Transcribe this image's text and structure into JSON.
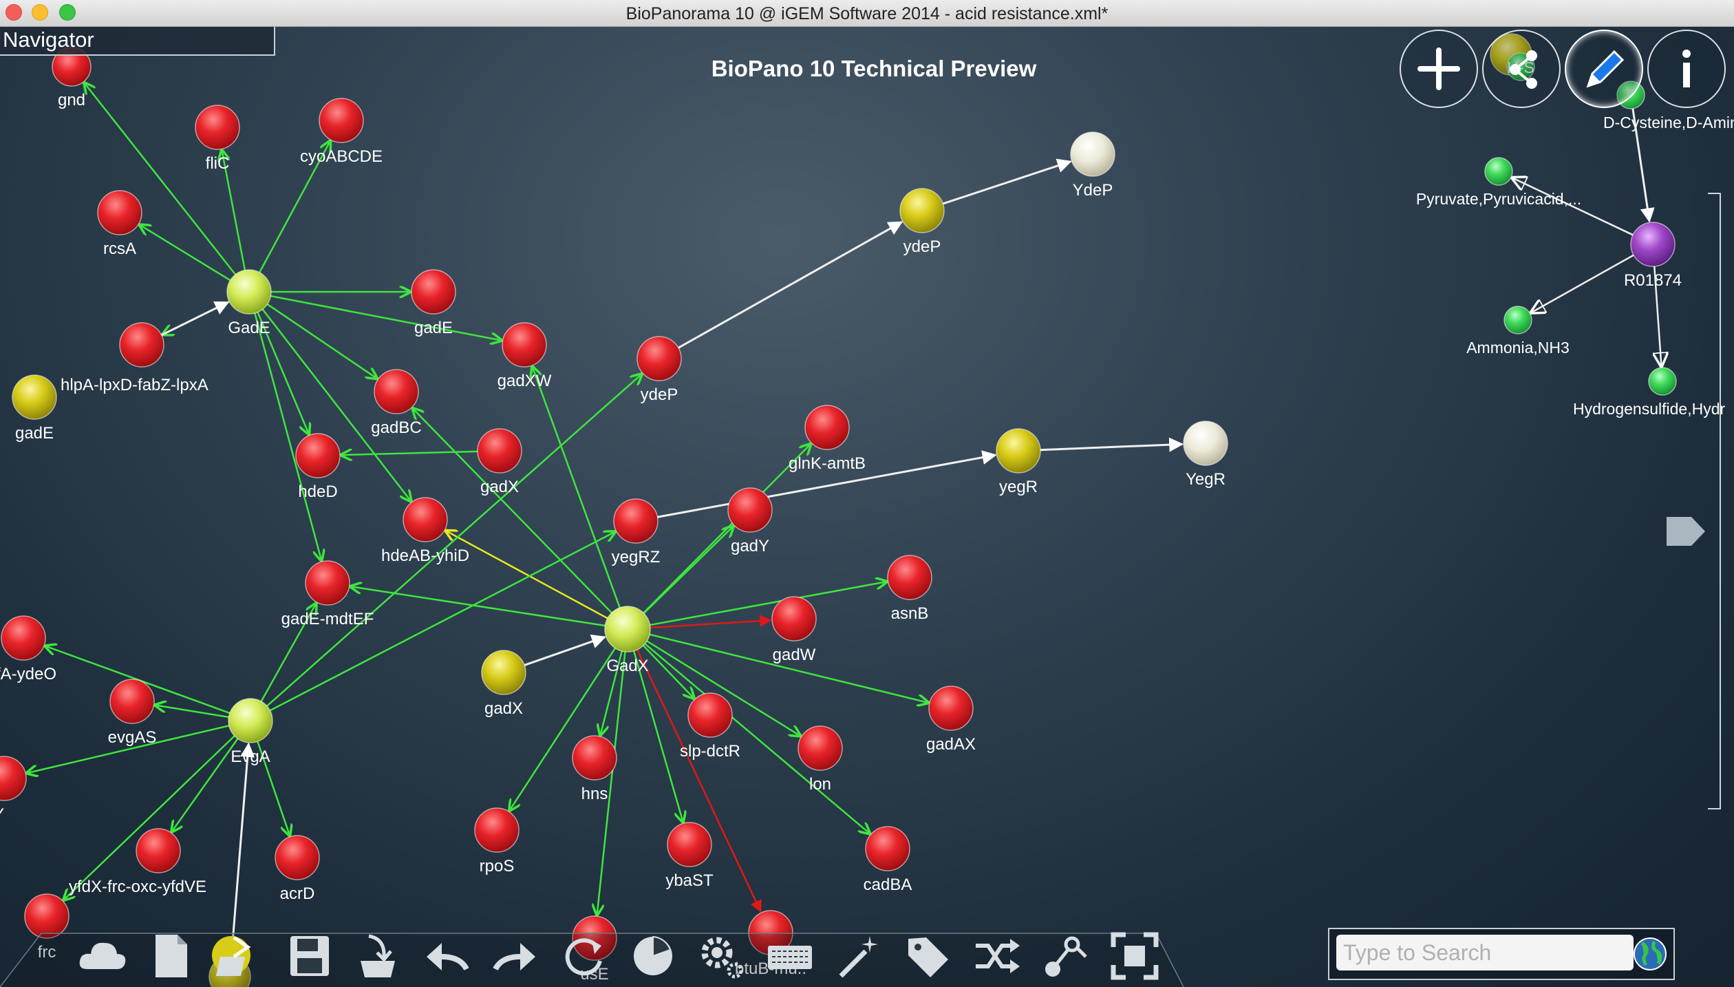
{
  "window": {
    "title": "BioPanorama 10 @ iGEM Software 2014 - acid resistance.xml*",
    "subtitle": "BioPano 10 Technical Preview"
  },
  "navigator": {
    "label": "Navigator"
  },
  "top_buttons": [
    {
      "name": "add-button",
      "icon": "plus-icon"
    },
    {
      "name": "share-button",
      "icon": "share-icon"
    },
    {
      "name": "edit-button",
      "icon": "pencil-icon",
      "active": true
    },
    {
      "name": "info-button",
      "icon": "info-icon"
    }
  ],
  "search": {
    "placeholder": "Type to Search",
    "value": ""
  },
  "bottom_toolbar": [
    "cloud-icon",
    "new-document-icon",
    "open-folder-icon",
    "save-icon",
    "import-icon",
    "undo-icon",
    "redo-icon",
    "refresh-icon",
    "pie-chart-icon",
    "settings-icon",
    "keyboard-icon",
    "magic-wand-icon",
    "tag-icon",
    "shuffle-icon",
    "connect-icon",
    "fullscreen-icon"
  ],
  "colors": {
    "activation": "#3ee63e",
    "repression": "#e01818",
    "inhibition_yellow": "#e8e820",
    "protein": "#d4ec5a",
    "gene": "#e8242a",
    "mrna": "#d8cc18",
    "product": "#ecead8",
    "compound": "#3ed85a",
    "reaction": "#a048c8",
    "background": "#2f4150"
  },
  "nodes": [
    {
      "id": "gnd",
      "label": "gnd",
      "type": "gene"
    },
    {
      "id": "fliC",
      "label": "fliC",
      "type": "gene"
    },
    {
      "id": "cyoABCDE",
      "label": "cyoABCDE",
      "type": "gene"
    },
    {
      "id": "rcsA",
      "label": "rcsA",
      "type": "gene"
    },
    {
      "id": "GadE",
      "label": "GadE",
      "type": "protein"
    },
    {
      "id": "gadE1",
      "label": "gadE",
      "type": "gene"
    },
    {
      "id": "gadXW",
      "label": "gadXW",
      "type": "gene"
    },
    {
      "id": "gadBC",
      "label": "gadBC",
      "type": "gene"
    },
    {
      "id": "hlpA",
      "label": "hlpA-lpxD-fabZ-lpxA",
      "type": "gene"
    },
    {
      "id": "gadE_m",
      "label": "gadE",
      "type": "mrna"
    },
    {
      "id": "hdeD",
      "label": "hdeD",
      "type": "gene"
    },
    {
      "id": "hdeAB",
      "label": "hdeAB-yhiD",
      "type": "gene"
    },
    {
      "id": "gadX_g",
      "label": "gadX",
      "type": "gene"
    },
    {
      "id": "ydeP_g",
      "label": "ydeP",
      "type": "gene"
    },
    {
      "id": "ydeP_m",
      "label": "ydeP",
      "type": "mrna"
    },
    {
      "id": "YdeP",
      "label": "YdeP",
      "type": "product"
    },
    {
      "id": "gadEmdtEF",
      "label": "gadE-mdtEF",
      "type": "gene"
    },
    {
      "id": "yegRZ",
      "label": "yegRZ",
      "type": "gene"
    },
    {
      "id": "gadY",
      "label": "gadY",
      "type": "gene"
    },
    {
      "id": "glnK",
      "label": "glnK-amtB",
      "type": "gene"
    },
    {
      "id": "yegR_m",
      "label": "yegR",
      "type": "mrna"
    },
    {
      "id": "YegR",
      "label": "YegR",
      "type": "product"
    },
    {
      "id": "asnB",
      "label": "asnB",
      "type": "gene"
    },
    {
      "id": "GadX",
      "label": "GadX",
      "type": "protein"
    },
    {
      "id": "gadW",
      "label": "gadW",
      "type": "gene"
    },
    {
      "id": "gadX_m",
      "label": "gadX",
      "type": "mrna"
    },
    {
      "id": "gadAX",
      "label": "gadAX",
      "type": "gene"
    },
    {
      "id": "slp",
      "label": "slp-dctR",
      "type": "gene"
    },
    {
      "id": "lon",
      "label": "lon",
      "type": "gene"
    },
    {
      "id": "hns",
      "label": "hns",
      "type": "gene"
    },
    {
      "id": "rpoS",
      "label": "rpoS",
      "type": "gene"
    },
    {
      "id": "ybaST",
      "label": "ybaST",
      "type": "gene"
    },
    {
      "id": "cadBA",
      "label": "cadBA",
      "type": "gene"
    },
    {
      "id": "usE",
      "label": "usE",
      "type": "gene"
    },
    {
      "id": "btuB",
      "label": "btuB-mu..",
      "type": "gene"
    },
    {
      "id": "safA",
      "label": "fA-ydeO",
      "type": "gene"
    },
    {
      "id": "evgAS",
      "label": "evgAS",
      "type": "gene"
    },
    {
      "id": "EvgA",
      "label": "EvgA",
      "type": "protein"
    },
    {
      "id": "rKY",
      "label": "rKY",
      "type": "gene"
    },
    {
      "id": "yfdX",
      "label": "yfdX-frc-oxc-yfdVE",
      "type": "gene"
    },
    {
      "id": "acrD",
      "label": "acrD",
      "type": "gene"
    },
    {
      "id": "frc",
      "label": "frc",
      "type": "gene"
    },
    {
      "id": "evgA_m",
      "label": "",
      "type": "mrna"
    },
    {
      "id": "topCompound",
      "label": "",
      "type": "mrna"
    },
    {
      "id": "H2S",
      "label": "H-S",
      "type": "compound"
    },
    {
      "id": "DCys",
      "label": "D-Cysteine,D-Amino...",
      "type": "compound"
    },
    {
      "id": "Pyruvate",
      "label": "Pyruvate,Pyruvicacid,...",
      "type": "compound"
    },
    {
      "id": "R01874",
      "label": "R01874",
      "type": "reaction"
    },
    {
      "id": "Ammonia",
      "label": "Ammonia,NH3",
      "type": "compound"
    },
    {
      "id": "HydroSulf",
      "label": "Hydrogensulfide,Hydr",
      "type": "compound"
    }
  ],
  "edges": [
    {
      "from": "GadE",
      "to": "gnd",
      "type": "activation"
    },
    {
      "from": "GadE",
      "to": "fliC",
      "type": "activation"
    },
    {
      "from": "GadE",
      "to": "cyoABCDE",
      "type": "activation"
    },
    {
      "from": "GadE",
      "to": "rcsA",
      "type": "activation"
    },
    {
      "from": "GadE",
      "to": "gadE1",
      "type": "activation"
    },
    {
      "from": "GadE",
      "to": "gadXW",
      "type": "activation"
    },
    {
      "from": "GadE",
      "to": "gadBC",
      "type": "activation"
    },
    {
      "from": "GadE",
      "to": "hdeD",
      "type": "activation"
    },
    {
      "from": "GadE",
      "to": "hdeAB",
      "type": "activation"
    },
    {
      "from": "GadE",
      "to": "gadEmdtEF",
      "type": "activation"
    },
    {
      "from": "GadE",
      "to": "hlpA",
      "type": "activation"
    },
    {
      "from": "hlpA",
      "to": "GadE",
      "type": "translation"
    },
    {
      "from": "ydeP_m",
      "to": "YdeP",
      "type": "translation"
    },
    {
      "from": "ydeP_g",
      "to": "ydeP_m",
      "type": "translation"
    },
    {
      "from": "yegRZ",
      "to": "yegR_m",
      "type": "translation"
    },
    {
      "from": "yegR_m",
      "to": "YegR",
      "type": "translation"
    },
    {
      "from": "gadX_m",
      "to": "GadX",
      "type": "translation"
    },
    {
      "from": "GadX",
      "to": "gadXW",
      "type": "activation"
    },
    {
      "from": "GadX",
      "to": "gadBC",
      "type": "activation"
    },
    {
      "from": "GadX",
      "to": "hdeAB",
      "type": "inhibition_yellow"
    },
    {
      "from": "GadX",
      "to": "gadEmdtEF",
      "type": "activation"
    },
    {
      "from": "GadX",
      "to": "gadY",
      "type": "activation"
    },
    {
      "from": "GadX",
      "to": "glnK",
      "type": "activation"
    },
    {
      "from": "GadX",
      "to": "asnB",
      "type": "activation"
    },
    {
      "from": "GadX",
      "to": "gadW",
      "type": "repression"
    },
    {
      "from": "GadX",
      "to": "gadAX",
      "type": "activation"
    },
    {
      "from": "GadX",
      "to": "slp",
      "type": "activation"
    },
    {
      "from": "GadX",
      "to": "lon",
      "type": "activation"
    },
    {
      "from": "GadX",
      "to": "hns",
      "type": "activation"
    },
    {
      "from": "GadX",
      "to": "rpoS",
      "type": "activation"
    },
    {
      "from": "GadX",
      "to": "ybaST",
      "type": "activation"
    },
    {
      "from": "GadX",
      "to": "cadBA",
      "type": "activation"
    },
    {
      "from": "GadX",
      "to": "usE",
      "type": "activation"
    },
    {
      "from": "GadX",
      "to": "btuB",
      "type": "repression"
    },
    {
      "from": "gadX_g",
      "to": "hdeD",
      "type": "activation"
    },
    {
      "from": "EvgA",
      "to": "safA",
      "type": "activation"
    },
    {
      "from": "EvgA",
      "to": "evgAS",
      "type": "activation"
    },
    {
      "from": "EvgA",
      "to": "rKY",
      "type": "activation"
    },
    {
      "from": "EvgA",
      "to": "yfdX",
      "type": "activation"
    },
    {
      "from": "EvgA",
      "to": "acrD",
      "type": "activation"
    },
    {
      "from": "EvgA",
      "to": "frc",
      "type": "activation"
    },
    {
      "from": "EvgA",
      "to": "gadEmdtEF",
      "type": "activation"
    },
    {
      "from": "EvgA",
      "to": "ydeP_g",
      "type": "activation"
    },
    {
      "from": "EvgA",
      "to": "yegRZ",
      "type": "activation"
    },
    {
      "from": "evgA_m",
      "to": "EvgA",
      "type": "translation"
    },
    {
      "from": "DCys",
      "to": "R01874",
      "type": "translation"
    },
    {
      "from": "R01874",
      "to": "Pyruvate",
      "type": "product_edge"
    },
    {
      "from": "R01874",
      "to": "Ammonia",
      "type": "product_edge"
    },
    {
      "from": "R01874",
      "to": "HydroSulf",
      "type": "product_edge"
    }
  ]
}
